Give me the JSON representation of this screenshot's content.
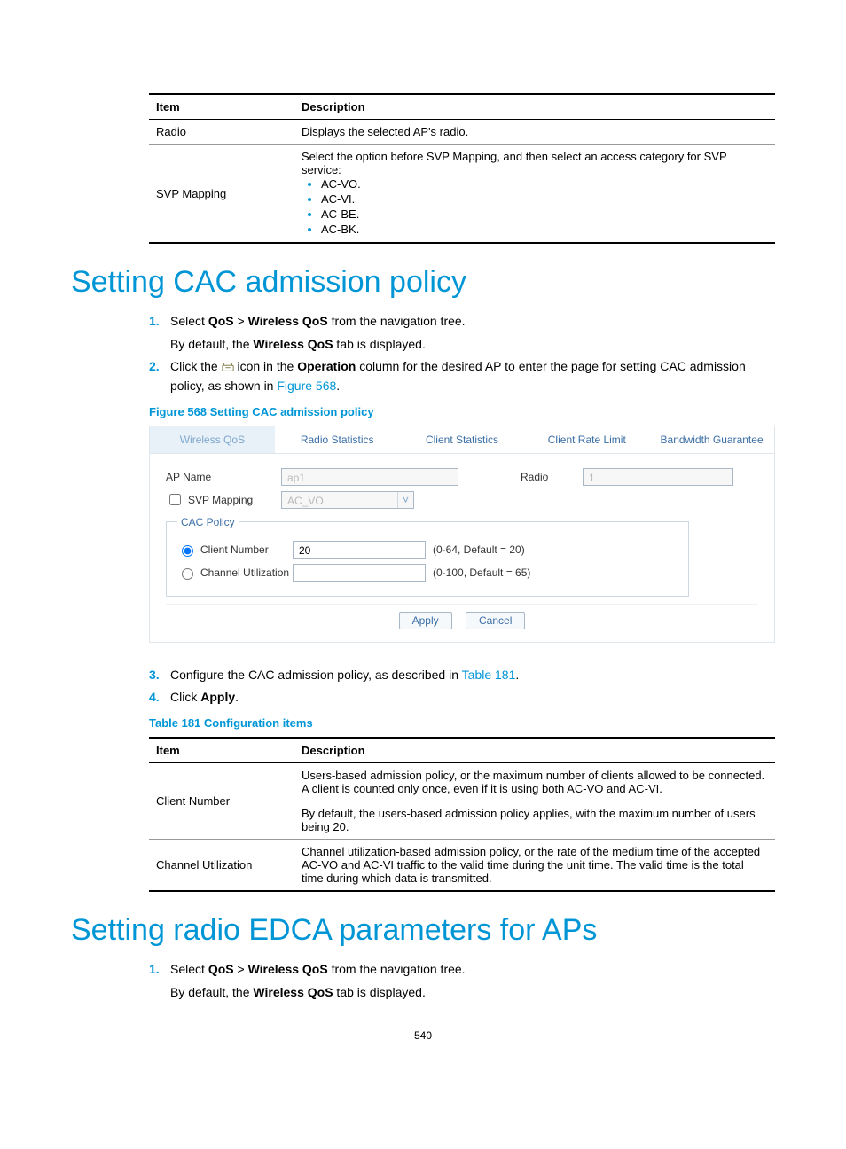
{
  "table_top": {
    "headers": [
      "Item",
      "Description"
    ],
    "row_radio": {
      "item": "Radio",
      "desc": "Displays the selected AP's radio."
    },
    "row_svp": {
      "item": "SVP Mapping",
      "lead": "Select the option before SVP Mapping, and then select an access category for SVP service:",
      "opts": [
        "AC-VO.",
        "AC-VI.",
        "AC-BE.",
        "AC-BK."
      ]
    }
  },
  "sec1": {
    "title": "Setting CAC admission policy",
    "s1_pre": "Select ",
    "s1_qos": "QoS",
    "s1_gt": " > ",
    "s1_wqos": "Wireless QoS",
    "s1_post": " from the navigation tree.",
    "s1_after_a": "By default, the ",
    "s1_after_b": "Wireless QoS",
    "s1_after_c": " tab is displayed.",
    "s2_a": "Click the ",
    "s2_b": " icon in the ",
    "s2_op": "Operation",
    "s2_c": " column for the desired AP to enter the page for setting CAC admission policy, as shown in ",
    "s2_link": "Figure 568",
    "s2_d": ".",
    "figcap": "Figure 568 Setting CAC admission policy",
    "s3_a": "Configure the CAC admission policy, as described in ",
    "s3_link": "Table 181",
    "s3_b": ".",
    "s4_a": "Click ",
    "s4_apply": "Apply",
    "s4_b": ".",
    "tablecap": "Table 181 Configuration items"
  },
  "figure": {
    "tabs": [
      "Wireless QoS",
      "Radio Statistics",
      "Client Statistics",
      "Client Rate Limit",
      "Bandwidth Guarantee"
    ],
    "ap_name_label": "AP Name",
    "ap_name_value": "ap1",
    "radio_label": "Radio",
    "radio_value": "1",
    "svp_label": "SVP Mapping",
    "svp_value": "AC_VO",
    "cac_legend": "CAC Policy",
    "client_num_label": "Client Number",
    "client_num_value": "20",
    "client_num_hint": "(0-64, Default = 20)",
    "chan_util_label": "Channel Utilization",
    "chan_util_value": "",
    "chan_util_hint": "(0-100, Default = 65)",
    "apply": "Apply",
    "cancel": "Cancel"
  },
  "table181": {
    "headers": [
      "Item",
      "Description"
    ],
    "r1": {
      "item": "Client Number",
      "d1": "Users-based admission policy, or the maximum number of clients allowed to be connected. A client is counted only once, even if it is using both AC-VO and AC-VI.",
      "d2": "By default, the users-based admission policy applies, with the maximum number of users being 20."
    },
    "r2": {
      "item": "Channel Utilization",
      "d1": "Channel utilization-based admission policy, or the rate of the medium time of the accepted AC-VO and AC-VI traffic to the valid time during the unit time. The valid time is the total time during which data is transmitted."
    }
  },
  "sec2": {
    "title": "Setting radio EDCA parameters for APs",
    "s1_pre": "Select ",
    "s1_qos": "QoS",
    "s1_gt": " > ",
    "s1_wqos": "Wireless QoS",
    "s1_post": " from the navigation tree.",
    "s1_after_a": "By default, the ",
    "s1_after_b": "Wireless QoS",
    "s1_after_c": " tab is displayed."
  },
  "page_number": "540"
}
